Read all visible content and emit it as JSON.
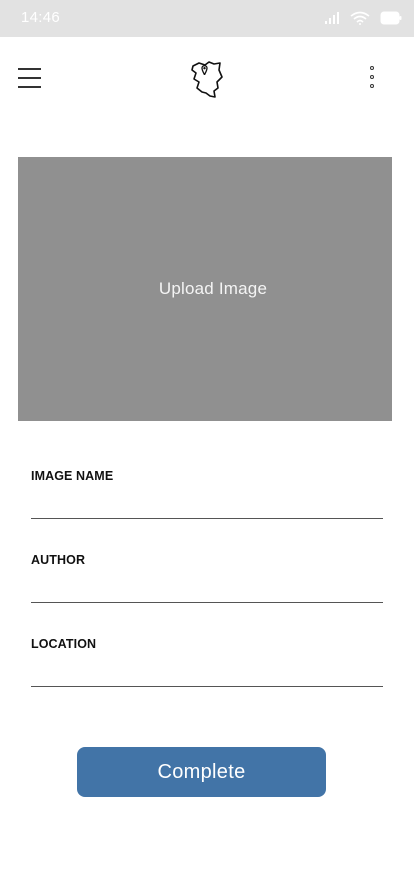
{
  "status_bar": {
    "time": "14:46",
    "icons": [
      "signal-icon",
      "wifi-icon",
      "battery-icon"
    ]
  },
  "app_bar": {
    "menu_icon": "hamburger-menu-icon",
    "logo_icon": "kenya-map-location-pin-icon",
    "more_icon": "more-vertical-icon"
  },
  "upload": {
    "label": "Upload Image"
  },
  "form": {
    "image_name": {
      "label": "IMAGE NAME",
      "value": "",
      "placeholder": ""
    },
    "author": {
      "label": "AUTHOR",
      "value": "",
      "placeholder": ""
    },
    "location": {
      "label": "LOCATION",
      "value": "",
      "placeholder": ""
    }
  },
  "actions": {
    "complete_label": "Complete"
  },
  "colors": {
    "status_bar_bg": "#e2e2e2",
    "upload_bg": "#909090",
    "primary_button": "#4274a7"
  }
}
